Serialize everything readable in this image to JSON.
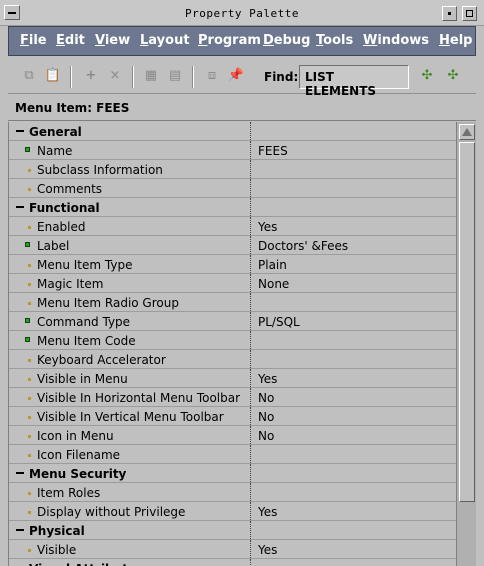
{
  "window": {
    "title": "Property Palette"
  },
  "menubar": {
    "items": [
      {
        "label": "File",
        "u": "F",
        "rest": "ile"
      },
      {
        "label": "Edit",
        "u": "E",
        "rest": "dit"
      },
      {
        "label": "View",
        "u": "V",
        "rest": "iew"
      },
      {
        "label": "Layout",
        "u": "L",
        "rest": "ayout"
      },
      {
        "label": "Program",
        "u": "P",
        "rest": "rogram"
      },
      {
        "label": "Debug",
        "u": "D",
        "rest": "ebug"
      },
      {
        "label": "Tools",
        "u": "T",
        "rest": "ools"
      },
      {
        "label": "Windows",
        "u": "W",
        "rest": "indows"
      },
      {
        "label": "Help",
        "u": "H",
        "rest": "elp"
      }
    ]
  },
  "toolbar": {
    "find_label": "Find:",
    "find_value": "LIST ELEMENTS"
  },
  "header": {
    "item_label": "Menu Item: FEES"
  },
  "properties": [
    {
      "kind": "cat",
      "label": "General",
      "value": ""
    },
    {
      "kind": "chg",
      "label": "Name",
      "value": "FEES"
    },
    {
      "kind": "def",
      "label": "Subclass Information",
      "value": ""
    },
    {
      "kind": "def",
      "label": "Comments",
      "value": ""
    },
    {
      "kind": "cat",
      "label": "Functional",
      "value": ""
    },
    {
      "kind": "def",
      "label": "Enabled",
      "value": "Yes"
    },
    {
      "kind": "chg",
      "label": "Label",
      "value": "Doctors' &Fees"
    },
    {
      "kind": "def",
      "label": "Menu Item Type",
      "value": "Plain"
    },
    {
      "kind": "def",
      "label": "Magic Item",
      "value": "None"
    },
    {
      "kind": "def",
      "label": "Menu Item Radio Group",
      "value": ""
    },
    {
      "kind": "chg",
      "label": "Command Type",
      "value": "PL/SQL"
    },
    {
      "kind": "chg",
      "label": "Menu Item Code",
      "value": ""
    },
    {
      "kind": "def",
      "label": "Keyboard Accelerator",
      "value": ""
    },
    {
      "kind": "def",
      "label": "Visible in Menu",
      "value": "Yes"
    },
    {
      "kind": "def",
      "label": "Visible In Horizontal Menu Toolbar",
      "value": "No"
    },
    {
      "kind": "def",
      "label": "Visible In Vertical Menu Toolbar",
      "value": "No"
    },
    {
      "kind": "def",
      "label": "Icon in Menu",
      "value": "No"
    },
    {
      "kind": "def",
      "label": "Icon Filename",
      "value": ""
    },
    {
      "kind": "cat",
      "label": "Menu Security",
      "value": ""
    },
    {
      "kind": "def",
      "label": "Item Roles",
      "value": ""
    },
    {
      "kind": "def",
      "label": "Display without Privilege",
      "value": "Yes"
    },
    {
      "kind": "cat",
      "label": "Physical",
      "value": ""
    },
    {
      "kind": "def",
      "label": "Visible",
      "value": "Yes"
    },
    {
      "kind": "cat",
      "label": "Visual Attributes",
      "value": ""
    }
  ],
  "colors": {
    "menubar_bg": "#6d7890",
    "changed_icon": "#2a9a2a",
    "default_icon": "#b89a30"
  }
}
